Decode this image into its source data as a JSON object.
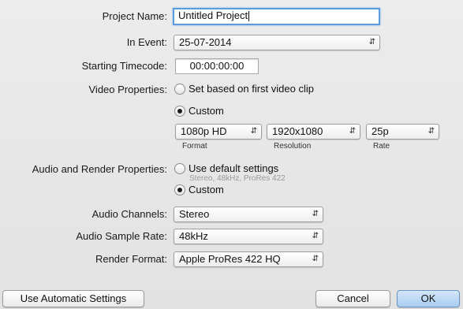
{
  "project_name": {
    "label": "Project Name:",
    "value": "Untitled Project"
  },
  "event": {
    "label": "In Event:",
    "value": "25-07-2014"
  },
  "timecode": {
    "label": "Starting Timecode:",
    "value": "00:00:00:00"
  },
  "video": {
    "label": "Video Properties:",
    "option_first_clip": "Set based on first video clip",
    "option_custom": "Custom",
    "format": {
      "value": "1080p HD",
      "caption": "Format"
    },
    "resolution": {
      "value": "1920x1080",
      "caption": "Resolution"
    },
    "rate": {
      "value": "25p",
      "caption": "Rate"
    }
  },
  "audio_render": {
    "label": "Audio and Render Properties:",
    "option_default": "Use default settings",
    "default_hint": "Stereo, 48kHz, ProRes 422",
    "option_custom": "Custom"
  },
  "audio_channels": {
    "label": "Audio Channels:",
    "value": "Stereo"
  },
  "audio_sample_rate": {
    "label": "Audio Sample Rate:",
    "value": "48kHz"
  },
  "render_format": {
    "label": "Render Format:",
    "value": "Apple ProRes 422 HQ"
  },
  "buttons": {
    "automatic": "Use Automatic Settings",
    "cancel": "Cancel",
    "ok": "OK"
  },
  "state": {
    "video_selected": "custom",
    "audio_render_selected": "custom",
    "focused_field": "project_name"
  },
  "colors": {
    "focus_ring": "#5b9be0",
    "default_button": "#a9cdf2",
    "background": "#e6e6e6"
  },
  "icons": {
    "popup_indicator": "chevron-updown-icon",
    "radio": "radio-button"
  }
}
